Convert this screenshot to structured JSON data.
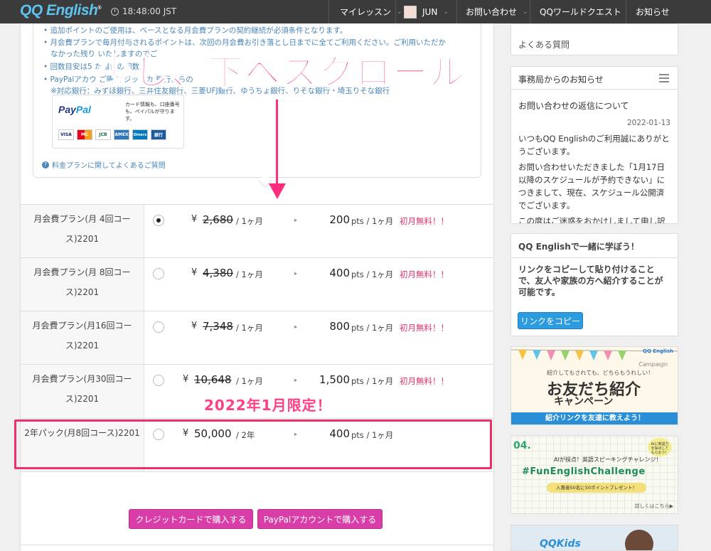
{
  "header": {
    "logo": "QQ English",
    "logo_mark": "®",
    "time": "18:48:00 JST",
    "nav": {
      "my_lesson": "マイレッスン",
      "user": "JUN",
      "contact": "お問い合わせ",
      "world_quest": "QQワールドクエスト",
      "news": "お知らせ"
    }
  },
  "info_box": {
    "lines": [
      "追加ポイントのご使用は、ベースとなる月会費プランの契約継続が必須条件となります。",
      "月会費プランで毎月付与されるポイントは、次回の月会費お引き落とし日までに全てご利用ください。ご利用いただか",
      "なかった残り                  いたしますのでご",
      "回数目安は5                            た場合の回数と",
      "PayPalアカウ                    ご購入                 ジットカ       銀行からの",
      "※対応銀行：みずほ銀行、三井住友銀行、三菱UFJ銀行、ゆうちょ銀行、りそな銀行・埼玉りそな銀行"
    ],
    "paypal": {
      "logo_pay": "Pay",
      "logo_pal": "Pal",
      "note": "カード情報も、口座番号も、ペイパルが守ります。",
      "cards": [
        "VISA",
        "MC",
        "JCB",
        "AMEX",
        "Diners",
        "銀行"
      ]
    },
    "faq_link": "料金プランに関してよくあるご質問"
  },
  "overlay": {
    "scroll_text": "少し、下へスクロール",
    "limited_text": "2022年1月限定！"
  },
  "plans": [
    {
      "name": "月会費プラン(月 4回コース)2201",
      "yen": "¥",
      "price": "2,680",
      "per": "/ 1ヶ月",
      "arrow": "▸",
      "pts": "200",
      "pts_unit": "pts / 1ヶ月",
      "promo": "初月無料！！",
      "checked": true
    },
    {
      "name": "月会費プラン(月 8回コース)2201",
      "yen": "¥",
      "price": "4,380",
      "per": "/ 1ヶ月",
      "arrow": "▸",
      "pts": "400",
      "pts_unit": "pts / 1ヶ月",
      "promo": "初月無料！！",
      "checked": false
    },
    {
      "name": "月会費プラン(月16回コース)2201",
      "yen": "¥",
      "price": "7,348",
      "per": "/ 1ヶ月",
      "arrow": "▸",
      "pts": "800",
      "pts_unit": "pts / 1ヶ月",
      "promo": "初月無料！！",
      "checked": false
    },
    {
      "name": "月会費プラン(月30回コース)2201",
      "yen": "¥",
      "price": "10,648",
      "per": "/ 1ヶ月",
      "arrow": "▸",
      "pts": "1,500",
      "pts_unit": "pts / 1ヶ月",
      "promo": "初月無料！！",
      "checked": false
    },
    {
      "name": "2年パック(月8回コース)2201",
      "yen": "¥",
      "price": "50,000",
      "per": "/ 2年",
      "arrow": "▸",
      "pts": "400",
      "pts_unit": "pts / 1ヶ月",
      "promo": "",
      "checked": false
    }
  ],
  "buttons": {
    "credit": "クレジットカードで購入する",
    "paypal": "PayPalアカウントで購入する"
  },
  "sidebar": {
    "faq": "よくある質問",
    "notice_title": "事務局からのお知らせ",
    "notice_item_title": "お問い合わせの返信について",
    "notice_date": "2022-01-13",
    "notice_p1": "いつもQQ Englishのご利用誠にありがとうございます。",
    "notice_p2": "お問い合わせいただきました「1月17日以降のスケジュールが予約できない」につきまして、現在、スケジュール公開済でございます。",
    "notice_p3": "この度はご迷惑をおかけしまして申し訳ご",
    "refer_title": "QQ Englishで一緒に学ぼう！",
    "refer_text": "リンクをコピーして貼り付けることで、友人や家族の方へ紹介することが可能です。",
    "copy_button": "リンクをコピー",
    "banner1": {
      "small": "紹介してもされても、どちらもうれしい！",
      "campaign": "Campaign",
      "main": "お友だち紹介",
      "sub": "キャンペーン",
      "strip": "紹介リンクを友達に教えよう！"
    },
    "banner2": {
      "num": "04.",
      "top": "AIが採点！英語スピーキングチャレンジ！",
      "title": "#FunEnglishChallenge",
      "prize": "入賞者50名に50ポイントプレゼント！",
      "more": "詳しくはこちら▶",
      "bubble": "AIに英語力を採点してもらおう！"
    },
    "banner3": {
      "logo": "QQKids"
    }
  },
  "colors": {
    "accent_pink": "#ff2d7e",
    "button_pink": "#d93ea8",
    "link_blue": "#4a86b8",
    "header_bg": "#3b3b3b",
    "copy_button": "#2d9be0"
  }
}
